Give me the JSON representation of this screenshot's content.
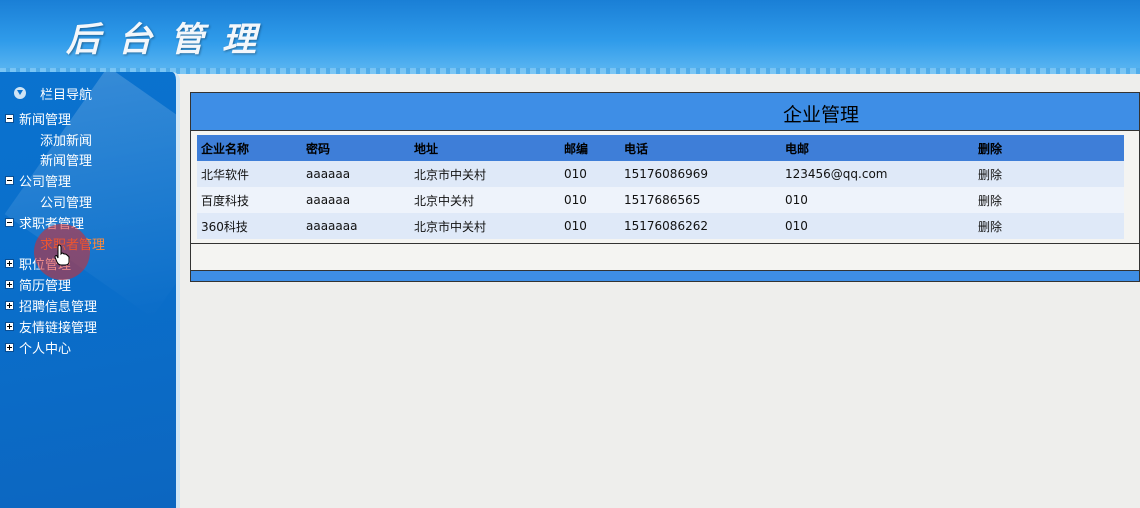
{
  "header": {
    "title": "后台管理"
  },
  "sidebar": {
    "nav_title": "栏目导航",
    "items": [
      {
        "label": "新闻管理",
        "type": "group",
        "expanded": true
      },
      {
        "label": "添加新闻",
        "type": "child"
      },
      {
        "label": "新闻管理",
        "type": "child"
      },
      {
        "label": "公司管理",
        "type": "group",
        "expanded": true
      },
      {
        "label": "公司管理",
        "type": "child"
      },
      {
        "label": "求职者管理",
        "type": "group",
        "expanded": true
      },
      {
        "label": "求职者管理",
        "type": "child",
        "active": true
      },
      {
        "label": "职位管理",
        "type": "group",
        "expanded": false
      },
      {
        "label": "简历管理",
        "type": "group",
        "expanded": false
      },
      {
        "label": "招聘信息管理",
        "type": "group",
        "expanded": false
      },
      {
        "label": "友情链接管理",
        "type": "group",
        "expanded": false
      },
      {
        "label": "个人中心",
        "type": "group",
        "expanded": false
      }
    ]
  },
  "main": {
    "title": "企业管理",
    "table": {
      "headers": [
        "企业名称",
        "密码",
        "地址",
        "邮编",
        "电话",
        "电邮",
        "删除"
      ],
      "rows": [
        [
          "北华软件",
          "aaaaaa",
          "北京市中关村",
          "010",
          "15176086969",
          "123456@qq.com",
          "删除"
        ],
        [
          "百度科技",
          "aaaaaa",
          "北京中关村",
          "010",
          "1517686565",
          "010",
          "删除"
        ],
        [
          "360科技",
          "aaaaaaa",
          "北京市中关村",
          "010",
          "15176086262",
          "010",
          "删除"
        ]
      ]
    }
  },
  "colors": {
    "header": "#2f9bea",
    "sidebar": "#0a72cf",
    "panel_bar": "#3e8ee6",
    "table_header": "#3e7ed8",
    "active_link": "#ff8a3a"
  }
}
